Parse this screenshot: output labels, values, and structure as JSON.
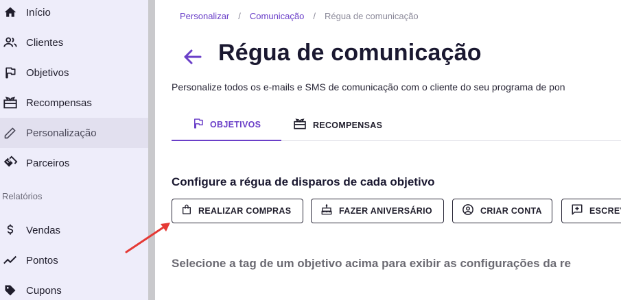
{
  "sidebar": {
    "items": [
      {
        "label": "Início",
        "icon": "home-icon"
      },
      {
        "label": "Clientes",
        "icon": "people-icon"
      },
      {
        "label": "Objetivos",
        "icon": "flag-icon"
      },
      {
        "label": "Recompensas",
        "icon": "gift-icon"
      },
      {
        "label": "Personalização",
        "icon": "pencil-icon",
        "active": true
      },
      {
        "label": "Parceiros",
        "icon": "handshake-icon"
      }
    ],
    "section_label": "Relatórios",
    "report_items": [
      {
        "label": "Vendas",
        "icon": "dollar-icon"
      },
      {
        "label": "Pontos",
        "icon": "trend-icon"
      },
      {
        "label": "Cupons",
        "icon": "tag-icon"
      }
    ]
  },
  "breadcrumb": {
    "items": [
      "Personalizar",
      "Comunicação"
    ],
    "current": "Régua de comunicação",
    "separator": "/"
  },
  "header": {
    "title": "Régua de comunicação",
    "subtitle": "Personalize todos os e-mails e SMS de comunicação com o cliente do seu programa de pon"
  },
  "tabs": [
    {
      "label": "OBJETIVOS",
      "icon": "flag-icon",
      "active": true
    },
    {
      "label": "RECOMPENSAS",
      "icon": "gift-icon",
      "active": false
    }
  ],
  "content": {
    "heading": "Configure a régua de disparos de cada objetivo",
    "chips": [
      {
        "label": "REALIZAR COMPRAS",
        "icon": "shopping-bag-icon"
      },
      {
        "label": "FAZER ANIVERSÁRIO",
        "icon": "cake-icon"
      },
      {
        "label": "CRIAR CONTA",
        "icon": "account-circle-icon"
      },
      {
        "label": "ESCREV",
        "icon": "add-comment-icon"
      }
    ],
    "hint": "Selecione a tag de um objetivo acima para exibir as configurações da re"
  },
  "colors": {
    "accent": "#6a3fc8",
    "sidebar_bg": "#eeedfa",
    "active_item_bg": "#e2e0ef",
    "annotation_arrow": "#e53935"
  }
}
